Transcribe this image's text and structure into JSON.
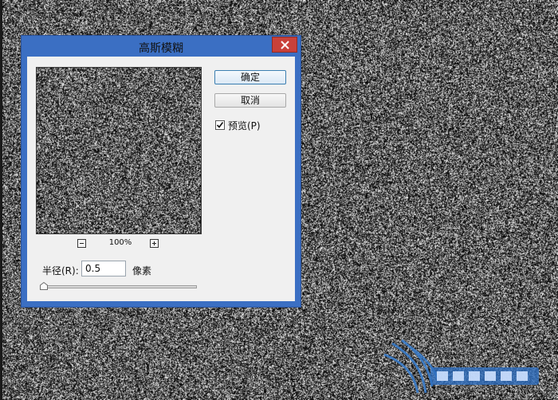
{
  "dialog": {
    "title": "高斯模糊",
    "ok_label": "确定",
    "cancel_label": "取消",
    "preview": {
      "label": "预览(P)",
      "checked": true
    },
    "zoom": {
      "level": "100%"
    },
    "radius": {
      "label": "半径(R):",
      "value": "0.5",
      "unit": "像素",
      "slider_fraction": 0.0
    }
  },
  "icons": {
    "close": "close-icon",
    "zoom_out": "minus-icon",
    "zoom_in": "plus-icon",
    "check": "checkmark-icon"
  },
  "colors": {
    "title_bar": "#3b6fc3",
    "close_button": "#c9413a",
    "dialog_body": "#f0f0f0",
    "noise_base": "#2e2e2e",
    "watermark": "#3a7fd0"
  }
}
